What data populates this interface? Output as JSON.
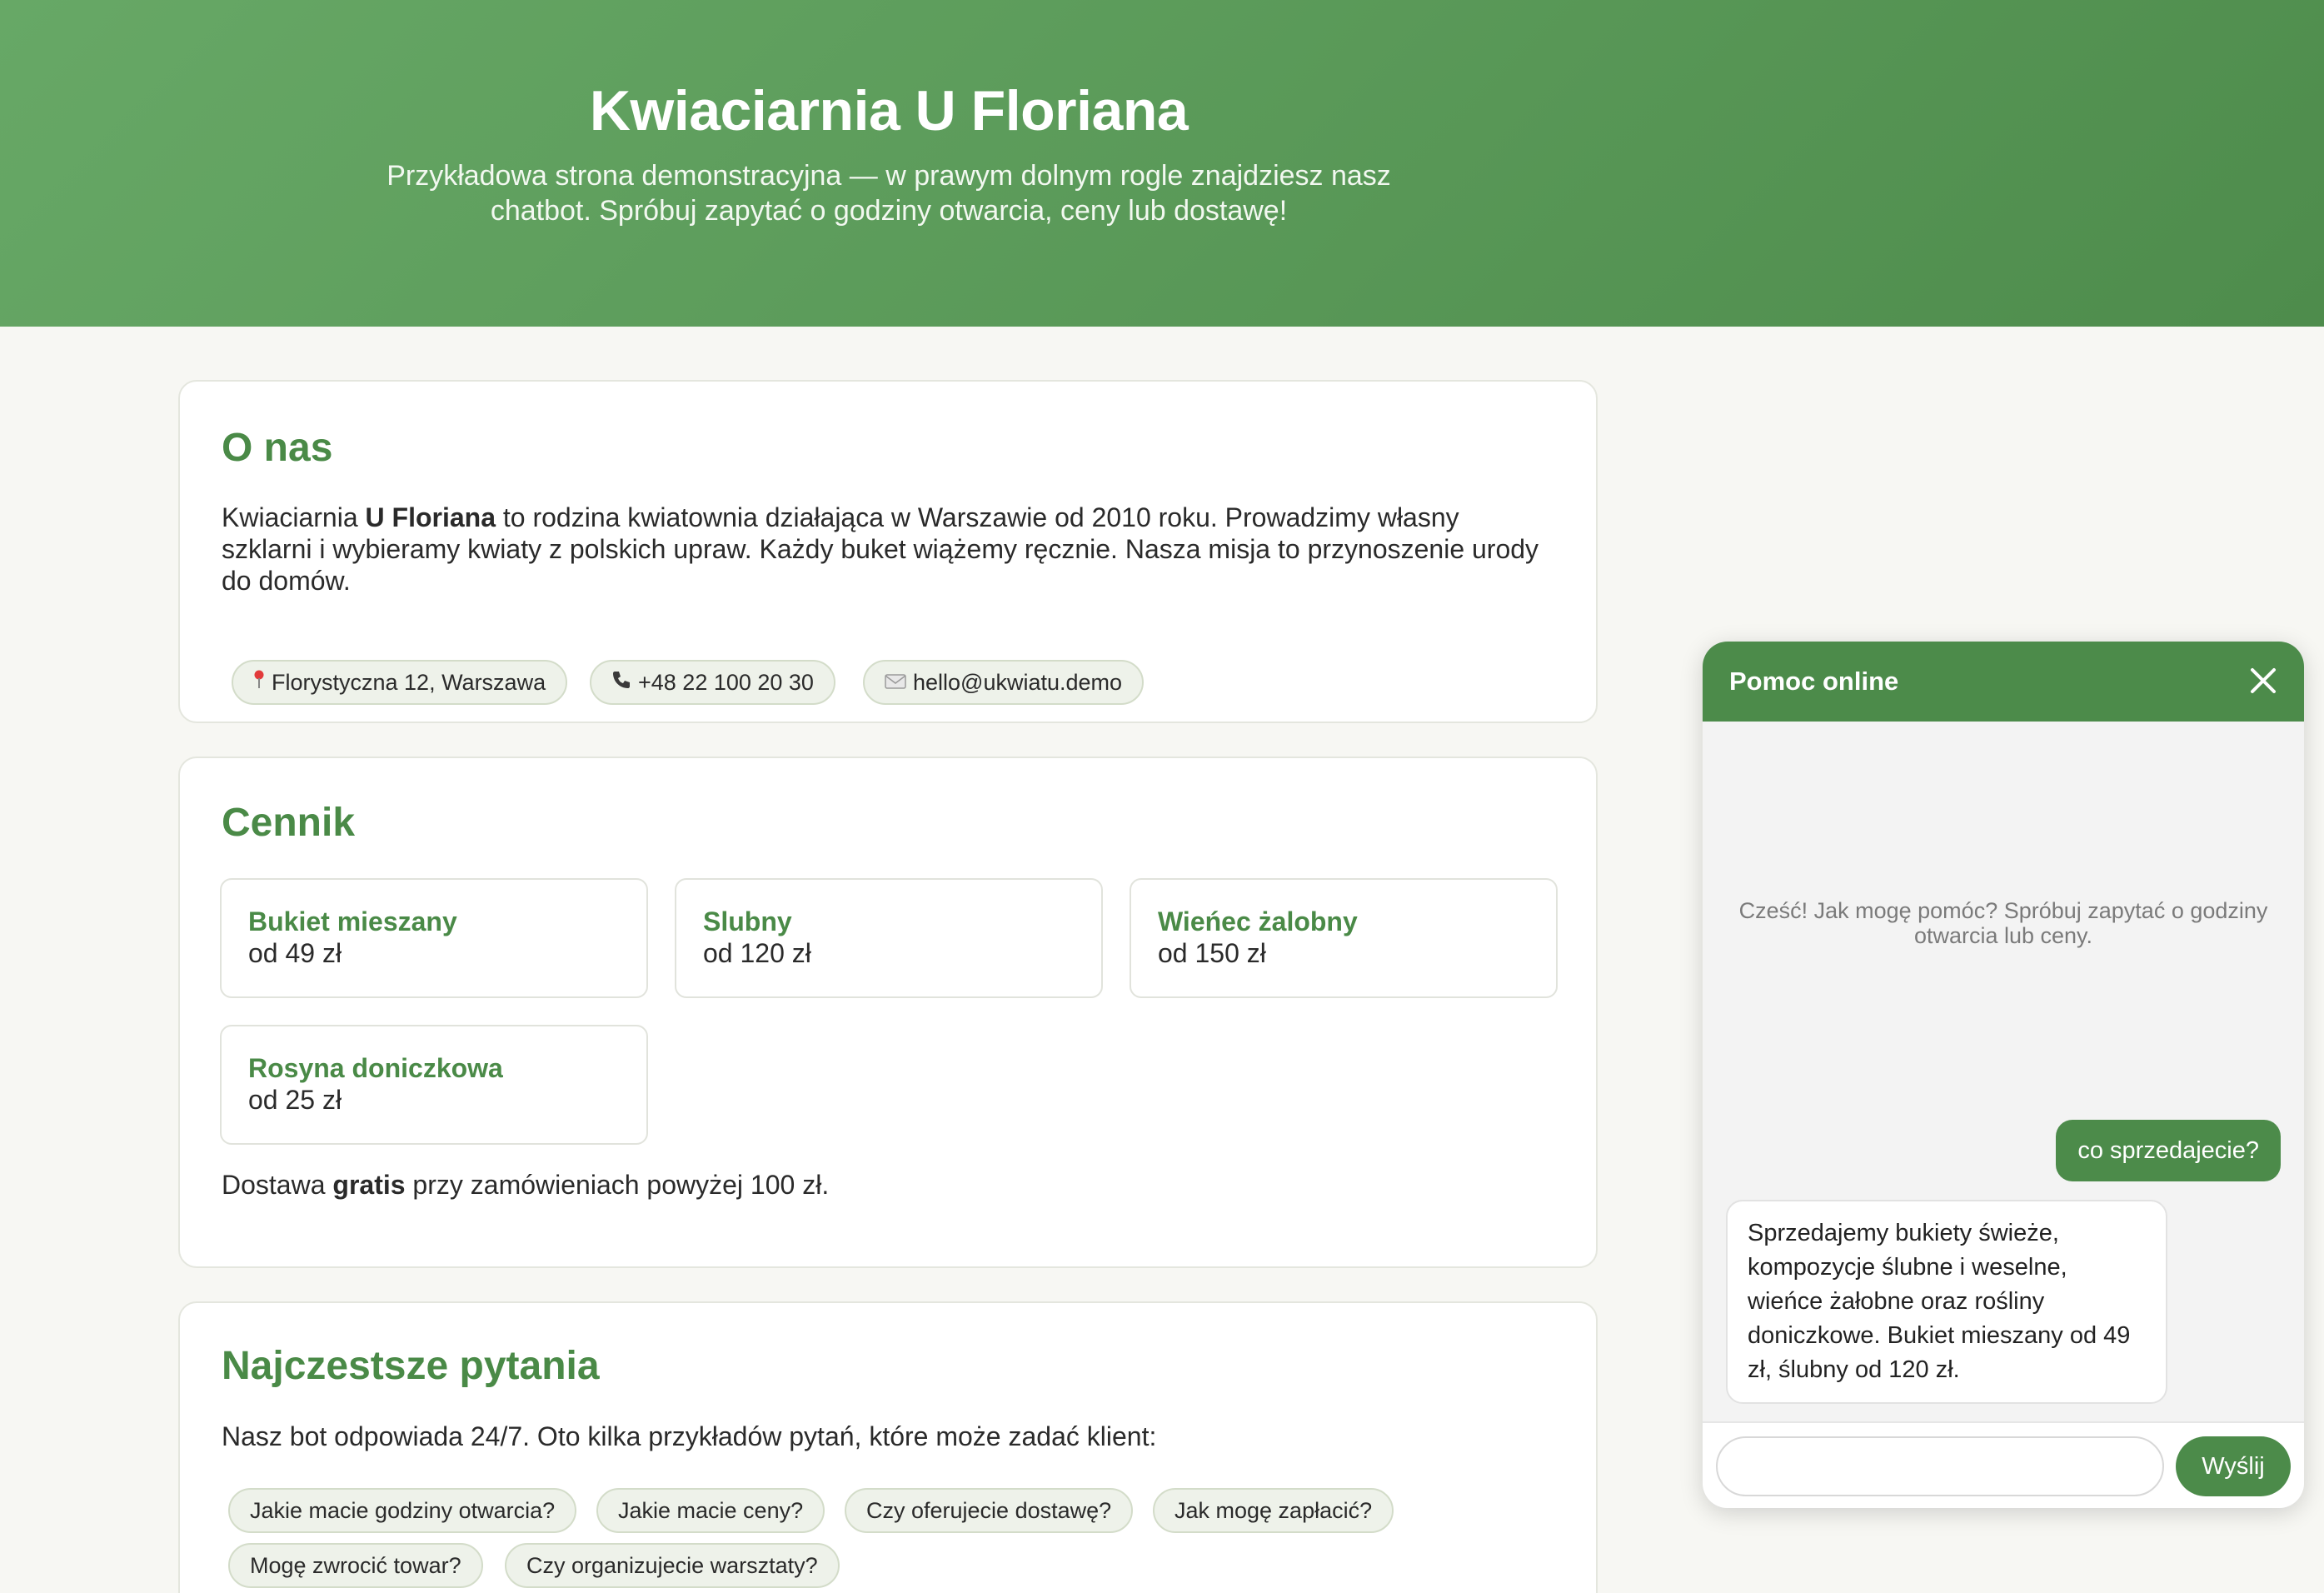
{
  "hero": {
    "title": "Kwiaciarnia U Floriana",
    "subtitle": "Przykładowa strona demonstracyjna — w prawym dolnym rogle znajdziesz nasz chatbot. Spróbuj zapytać o godziny otwarcia, ceny lub dostawę!"
  },
  "about": {
    "heading": "O nas",
    "text_before": "Kwiaciarnia ",
    "text_bold": "U Floriana",
    "text_after": " to rodzina kwiatownia działająca w Warszawie od 2010 roku. Prowadzimy własny szklarni i wybieramy kwiaty z polskich upraw. Każdy buket wiążemy ręcznie. Nasza misja to przynoszenie urody do domów.",
    "contacts": [
      {
        "icon": "map-pin-icon",
        "text": "Florystyczna 12, Warszawa"
      },
      {
        "icon": "phone-icon",
        "text": "+48 22 100 20 30"
      },
      {
        "icon": "envelope-icon",
        "text": "hello@ukwiatu.demo"
      }
    ]
  },
  "pricing": {
    "heading": "Cennik",
    "items": [
      {
        "name": "Bukiet mieszany",
        "price": "od 49 zł"
      },
      {
        "name": "Slubny",
        "price": "od 120 zł"
      },
      {
        "name": "Wieńec żalobny",
        "price": "od 150 zł"
      },
      {
        "name": "Rosyna doniczkowa",
        "price": "od 25 zł"
      }
    ],
    "delivery_before": "Dostawa ",
    "delivery_bold": "gratis",
    "delivery_after": " przy zamówieniach powyżej 100 zł."
  },
  "faq": {
    "heading": "Najczestsze pytania",
    "intro": "Nasz bot odpowiada 24/7. Oto kilka przykładów pytań, które może zadać klient:",
    "questions": [
      "Jakie macie godziny otwarcia?",
      "Jakie macie ceny?",
      "Czy oferujecie dostawę?",
      "Jak mogę zapłacić?",
      "Mogę zwrocić towar?",
      "Czy organizujecie warsztaty?"
    ]
  },
  "chat": {
    "title": "Pomoc online",
    "hint": "Cześć! Jak mogę pomóc? Spróbuj zapytać o godziny otwarcia lub ceny.",
    "user_message": "co sprzedajecie?",
    "bot_message": "Sprzedajemy bukiety świeże, kompozycje ślubne i weselne, wieńce żałobne oraz rośliny doniczkowe. Bukiet mieszany od 49 zł, ślubny od 120 zł.",
    "input_value": "",
    "send_label": "Wyślij"
  },
  "colors": {
    "accent": "#4c8b4a",
    "header_gradient_start": "#67a866",
    "header_gradient_end": "#4e8c4c",
    "page_background": "#f7f7f3"
  }
}
